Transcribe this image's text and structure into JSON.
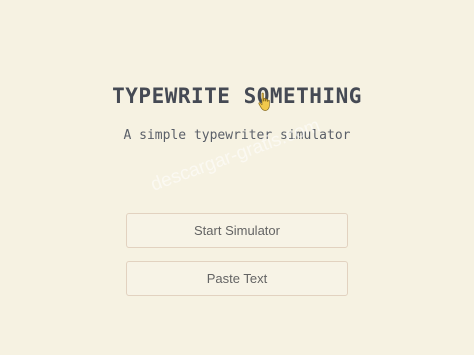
{
  "header": {
    "title": "TYPEWRITE SOMETHING",
    "subtitle": "A simple typewriter simulator"
  },
  "actions": {
    "start_label": "Start Simulator",
    "paste_label": "Paste Text"
  },
  "watermark": {
    "text": "descargar-gratis.com"
  },
  "icons": {
    "cursor": "hand-pointer-icon"
  },
  "colors": {
    "background": "#f6f2e2",
    "title": "#454a54",
    "button_border": "#e2d2c0",
    "button_text": "#646464",
    "cursor": "#f2c94c"
  }
}
